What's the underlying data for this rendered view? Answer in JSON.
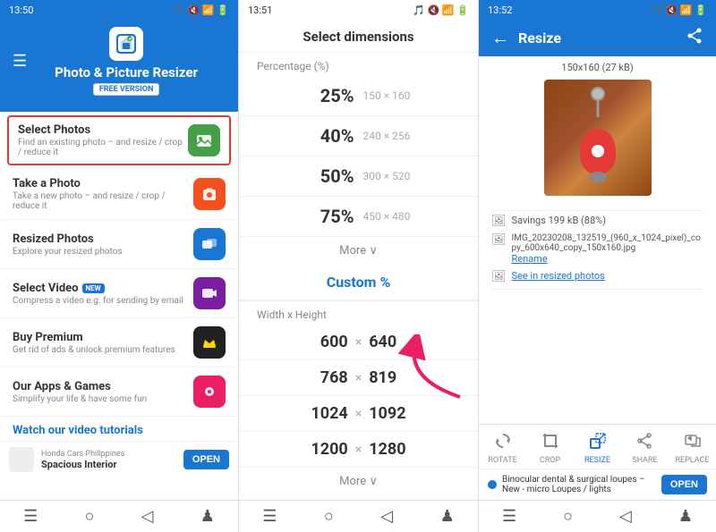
{
  "phone1": {
    "status": {
      "time": "13:50",
      "icons": "🎵 🔇 📶 🔋"
    },
    "header": {
      "app_title": "Photo & Picture Resizer",
      "free_badge": "FREE VERSION"
    },
    "menu_items": [
      {
        "id": "select-photos",
        "title": "Select Photos",
        "subtitle": "Find an existing photo – and resize / crop / reduce it",
        "icon_color": "green",
        "selected": true
      },
      {
        "id": "take-photo",
        "title": "Take a Photo",
        "subtitle": "Take a new photo – and resize / crop / reduce it",
        "icon_color": "orange",
        "selected": false
      },
      {
        "id": "resized-photos",
        "title": "Resized Photos",
        "subtitle": "Explore your resized photos",
        "icon_color": "blue",
        "selected": false
      },
      {
        "id": "select-video",
        "title": "Select Video",
        "subtitle": "Compress a video e.g. for sending by email",
        "icon_color": "purple",
        "is_new": true,
        "selected": false
      },
      {
        "id": "buy-premium",
        "title": "Buy Premium",
        "subtitle": "Get rid of ads & unlock premium features",
        "icon_color": "dark",
        "selected": false
      },
      {
        "id": "our-apps",
        "title": "Our Apps & Games",
        "subtitle": "Simplify your life & have some fun",
        "icon_color": "pink",
        "selected": false
      }
    ],
    "watch_tutorials": "Watch our video tutorials",
    "ad": {
      "source": "Honda Cars Philippines",
      "title": "Spacious Interior",
      "open_btn": "OPEN"
    },
    "new_label": "NEW"
  },
  "phone2": {
    "status": {
      "time": "13:51"
    },
    "header": "Select dimensions",
    "percentage_label": "Percentage (%)",
    "percentages": [
      {
        "value": "25%",
        "size": "150 × 160"
      },
      {
        "value": "40%",
        "size": "240 × 256"
      },
      {
        "value": "50%",
        "size": "300 × 520"
      },
      {
        "value": "75%",
        "size": "450 × 480"
      }
    ],
    "more_label": "More ∨",
    "custom_label": "Custom %",
    "wh_label": "Width x Height",
    "wh_values": [
      {
        "w": "600",
        "h": "640"
      },
      {
        "w": "768",
        "h": "819"
      },
      {
        "w": "1024",
        "h": "1092"
      },
      {
        "w": "1200",
        "h": "1280"
      }
    ],
    "more2_label": "More ∨"
  },
  "phone3": {
    "status": {
      "time": "13:52"
    },
    "header_title": "Resize",
    "photo_label": "150x160 (27 kB)",
    "info": {
      "savings": "Savings 199 kB (88%)",
      "filename": "IMG_20230208_132519_(960_x_1024_pixel)_copy_600x640_copy_150x160.jpg",
      "rename": "Rename",
      "see_resized": "See in resized photos"
    },
    "toolbar": [
      {
        "id": "rotate",
        "label": "ROTATE"
      },
      {
        "id": "crop",
        "label": "CROP"
      },
      {
        "id": "resize",
        "label": "RESIZE",
        "active": true
      },
      {
        "id": "share",
        "label": "SHARE"
      },
      {
        "id": "replace",
        "label": "REPLACE"
      }
    ],
    "ad": {
      "title": "Binocular dental & surgical loupes – New - micro Loupes / lights",
      "open_btn": "OPEN"
    }
  }
}
